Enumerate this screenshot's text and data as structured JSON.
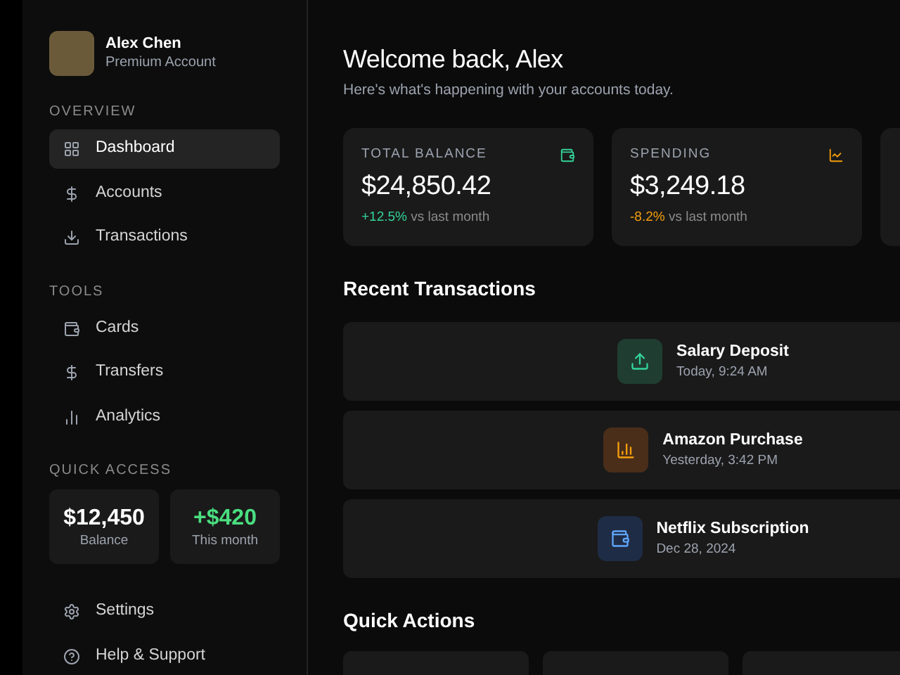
{
  "user": {
    "name": "Alex Chen",
    "plan": "Premium Account"
  },
  "nav_sections": [
    {
      "title": "OVERVIEW",
      "items": [
        {
          "label": "Dashboard",
          "kind": "grid",
          "selected": true
        },
        {
          "label": "Accounts",
          "kind": "dollar",
          "selected": false
        },
        {
          "label": "Transactions",
          "kind": "download",
          "selected": false
        }
      ]
    },
    {
      "title": "TOOLS",
      "items": [
        {
          "label": "Cards",
          "kind": "wallet",
          "selected": false
        },
        {
          "label": "Transfers",
          "kind": "dollar",
          "selected": false
        },
        {
          "label": "Analytics",
          "kind": "bars",
          "selected": false
        }
      ]
    }
  ],
  "quick_access": {
    "title": "QUICK ACCESS",
    "tiles": [
      {
        "value": "$12,450",
        "label": "Balance",
        "kind": "plain"
      },
      {
        "value": "+$420",
        "label": "This month",
        "kind": "gain"
      }
    ]
  },
  "footer_items": [
    {
      "label": "Settings",
      "kind": "gear"
    },
    {
      "label": "Help & Support",
      "kind": "help"
    }
  ],
  "main": {
    "greeting": "Welcome back, Alex",
    "subtitle": "Here's what's happening with your accounts today.",
    "stats": [
      {
        "label": "TOTAL BALANCE",
        "value": "$24,850.42",
        "change": "+12.5%",
        "note": "vs last month",
        "kind": "balance"
      },
      {
        "label": "SPENDING",
        "value": "$3,249.18",
        "change": "-8.2%",
        "note": "vs last month",
        "kind": "spending"
      }
    ],
    "recent_title": "Recent Transactions",
    "transactions": [
      {
        "title": "Salary Deposit",
        "time": "Today, 9:24 AM",
        "kind": "income"
      },
      {
        "title": "Amazon Purchase",
        "time": "Yesterday, 3:42 PM",
        "kind": "shopping"
      },
      {
        "title": "Netflix Subscription",
        "time": "Dec 28, 2024",
        "kind": "subscription"
      }
    ],
    "actions_title": "Quick Actions"
  }
}
